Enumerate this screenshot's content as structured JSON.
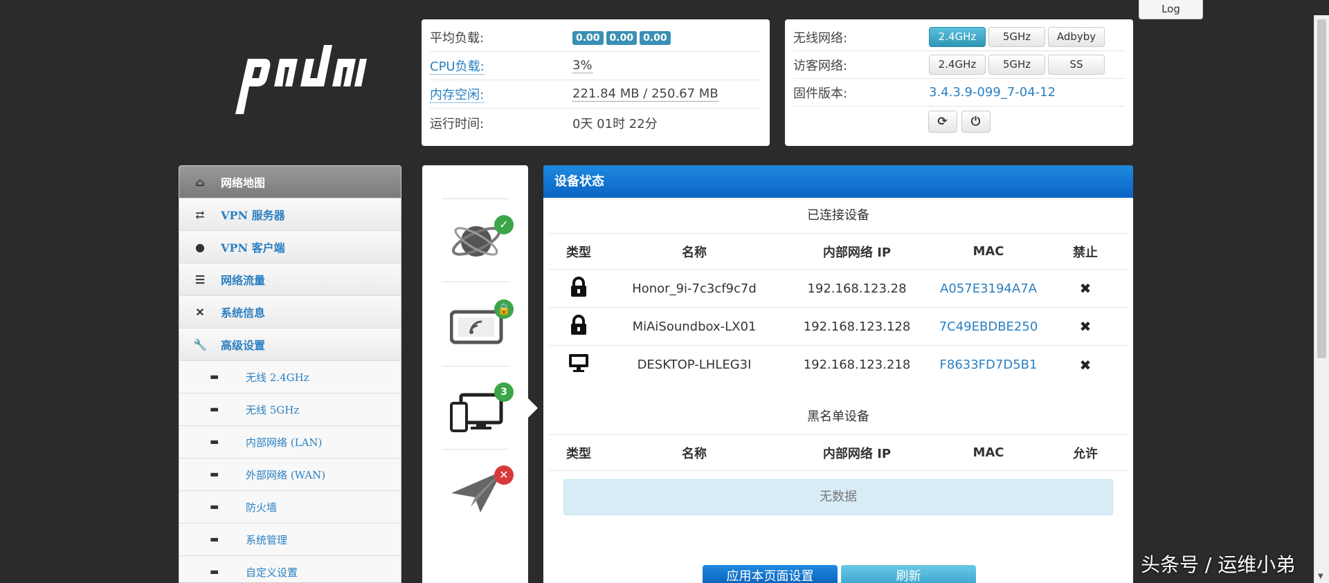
{
  "log_button": "Log",
  "system": {
    "avg_load_label": "平均负载:",
    "avg_load_values": [
      "0.00",
      "0.00",
      "0.00"
    ],
    "cpu_label": "CPU负载:",
    "cpu_value": "3%",
    "mem_label": "内存空闲:",
    "mem_value": "221.84 MB / 250.67 MB",
    "uptime_label": "运行时间:",
    "uptime_value": "0天 01时 22分"
  },
  "network": {
    "wireless_label": "无线网络:",
    "wireless_buttons": [
      "2.4GHz",
      "5GHz",
      "Adbyby"
    ],
    "guest_label": "访客网络:",
    "guest_buttons": [
      "2.4GHz",
      "5GHz",
      "SS"
    ],
    "firmware_label": "固件版本:",
    "firmware_value": "3.4.3.9-099_7-04-12"
  },
  "menu": {
    "items": [
      {
        "label": "网络地图"
      },
      {
        "label": "VPN 服务器"
      },
      {
        "label": "VPN 客户端"
      },
      {
        "label": "网络流量"
      },
      {
        "label": "系统信息"
      },
      {
        "label": "高级设置"
      }
    ],
    "subitems": [
      "无线 2.4GHz",
      "无线 5GHz",
      "内部网络 (LAN)",
      "外部网络 (WAN)",
      "防火墙",
      "系统管理",
      "自定义设置"
    ]
  },
  "status_icons": {
    "devices_count": "3"
  },
  "device_status": {
    "title": "设备状态",
    "connected_title": "已连接设备",
    "connected_headers": [
      "类型",
      "名称",
      "内部网络 IP",
      "MAC",
      "禁止"
    ],
    "connected_rows": [
      {
        "name": "Honor_9i-7c3cf9c7d",
        "ip": "192.168.123.28",
        "mac": "A057E3194A7A"
      },
      {
        "name": "MiAiSoundbox-LX01",
        "ip": "192.168.123.128",
        "mac": "7C49EBDBE250"
      },
      {
        "name": "DESKTOP-LHLEG3I",
        "ip": "192.168.123.218",
        "mac": "F8633FD7D5B1"
      }
    ],
    "blacklist_title": "黑名单设备",
    "blacklist_headers": [
      "类型",
      "名称",
      "内部网络 IP",
      "MAC",
      "允许"
    ],
    "no_data": "无数据",
    "apply_button": "应用本页面设置",
    "refresh_button": "刷新"
  },
  "watermark": "头条号 / 运维小弟"
}
